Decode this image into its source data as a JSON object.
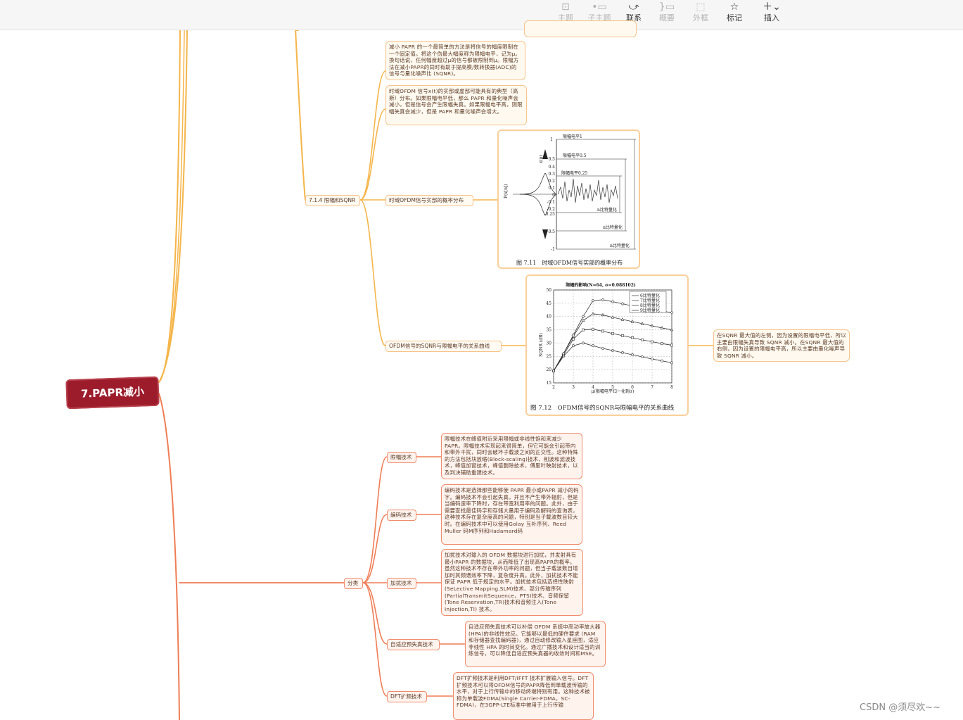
{
  "toolbar": {
    "items": [
      {
        "label": "主题",
        "icon": "topic-icon",
        "enabled": false
      },
      {
        "label": "子主题",
        "icon": "subtopic-icon",
        "enabled": false
      },
      {
        "label": "联系",
        "icon": "relationship-icon",
        "enabled": true
      },
      {
        "label": "概要",
        "icon": "summary-icon",
        "enabled": false
      },
      {
        "label": "外框",
        "icon": "boundary-icon",
        "enabled": false
      },
      {
        "label": "标记",
        "icon": "star-icon",
        "enabled": true
      },
      {
        "label": "插入",
        "icon": "plus-icon",
        "enabled": true
      }
    ]
  },
  "root": {
    "label": "7.PAPR减小"
  },
  "section": {
    "label": "7.1.4 限幅和SQNR",
    "note1": "减小 PAPR 的一个最简单的方法是将信号的幅度限制在一个固定值。将这个伪最大幅度称为限幅电平，记为μ。换句话说，任何幅度超过μ的信号都被限制到μ。限幅方法在减小PAPR的同时有助于提高模/数转换器(ADC)的信号与量化噪声比 (SQNR)。",
    "note2": "时域OFDM 信号x(t)的实部或虚部可能具有的典型（高斯）分布。如果限幅电平低，那么 PAPR 和量化噪声会减小，但是信号会产生限幅失真。如果限幅电平高，则限幅失真会减少，但是 PAPR 和量化噪声会增大。",
    "prob_label": "时域OFDM信号实部的概率分布",
    "sqnr_label": "OFDM信号的SQNR与限幅电平的关系曲线",
    "sqnr_note": "在SQNR 最大值的左侧，因为设置的限幅电平低，所以主要由限幅失真导致 SQNR 减小。在SQNR 最大值的右侧，因为设置的限幅电平高，所以主要由量化噪声导致 SQNR 减小。"
  },
  "figure711": {
    "caption": "图 7.11　时域OFDM信号实部的概率分布",
    "level1": "限幅电平1",
    "level05": "限幅电平0.5",
    "level025": "限幅电平0.25",
    "q1": "n比特量化",
    "q2": "n比特量化",
    "q3": "n比特量化",
    "pdf_label": "P(x[n])",
    "xn_label": "x(n)",
    "ticks": [
      "1",
      "0.5",
      "0.4",
      "0.3",
      "0.2",
      "0.1",
      "0",
      "-0.1",
      "-0.2",
      "-0.25",
      "-0.5",
      "-1"
    ]
  },
  "chart_data": {
    "type": "line",
    "title": "限幅的影响(N=64, σ=0.088102)",
    "xlabel": "μ(限幅电平归一化到σ)",
    "ylabel": "SQNR (dB)",
    "xlim": [
      2,
      8
    ],
    "ylim": [
      15,
      50
    ],
    "xticks": [
      "2",
      "3",
      "4",
      "5",
      "6",
      "7",
      "8"
    ],
    "yticks": [
      "15",
      "20",
      "25",
      "30",
      "35",
      "40",
      "45",
      "50"
    ],
    "legend": "top-right",
    "grid": true,
    "x": [
      2,
      2.5,
      3,
      3.5,
      4,
      4.5,
      5,
      5.5,
      6,
      6.5,
      7,
      7.5,
      8
    ],
    "series": [
      {
        "name": "6比特量化",
        "values": [
          19.5,
          25,
          29,
          30,
          29,
          28,
          27.2,
          26.4,
          25.6,
          24.8,
          24,
          23.3,
          22.6
        ]
      },
      {
        "name": "7比特量化",
        "values": [
          19.5,
          25.5,
          31.5,
          35,
          35.2,
          34.5,
          33.6,
          32.8,
          32,
          31.2,
          30.5,
          29.8,
          29.2
        ]
      },
      {
        "name": "8比特量化",
        "values": [
          19.5,
          26,
          32.5,
          38.5,
          41,
          40.6,
          39.7,
          38.9,
          38.1,
          37.3,
          36.5,
          35.7,
          35
        ]
      },
      {
        "name": "9比特量化",
        "values": [
          19.5,
          26,
          33,
          40,
          46,
          46.3,
          45.6,
          44.8,
          44,
          43.3,
          42.6,
          42,
          41.5
        ]
      }
    ]
  },
  "figure712": {
    "caption": "图 7.12　OFDM信号的SQNR与限幅电平的关系曲线"
  },
  "classify": {
    "label": "分类",
    "items": [
      {
        "label": "限幅技术",
        "text": "限幅技术在峰值附近采用限幅或非线性饱和来减少PAPR。限幅技术实现起来很简单，但它可能会引起带内和带外干扰，同时会破坏子载波之间的正交性。这种特殊的方法包括块放缩(Block-scaling)技术、削波和滤波技术，峰值加窗技术，峰值删除技术，傅里叶映射技术，以及判决辅助重建技术。"
      },
      {
        "label": "编码技术",
        "text": "编码技术是选择那些能够使 PAPR 最小或PAPR 减小的码字。编码技术不会引起失真，并且不产生带外辐射，但是当编码速率下降时，存在带宽利用率的问题。此外，由于需要查找最佳码字和存储大量用于编码及解码的查询表，这种技术存在复杂度高的问题，特别是当子载波数目较大时。在编码技术中可以使用Golay 互补序列、Reed Muller 码M序列和Hadamard码"
      },
      {
        "label": "加扰技术",
        "text": "加扰技术对输入的 OFDM 数据块进行加扰，并发射具有最小PAPR 的数据块，从而降低了出现高PAPR的概率。虽然这种技术不存在带外功率的问题，但当子载波数目增加时其频谱效率下降，复杂度升高。此外，加扰技术不能保证 PAPR 低于规定的水平。加扰技术包括选择性映射(SeLective Mapping,SLM)技术、部分传输序列(PartialTransmitSequence，PTS)技术、音频保留(Tone Reservation,TR)技术和音频注入(Tone Injection,TI) 技术。"
      },
      {
        "label": "自适应预失真技术",
        "text": "自适应预失真技术可以补偿 OFDM 系统中高功率放大器 (HPA)的非线性效应。它能够以最低的硬件要求 (RAM 和存储器查找编码器)，通过自动修改输入星座图，适应非线性 HPA 的时间变化。通过广播技术和设计适当的训练信号，可以降低自适应预失真器的收敛时间和MSE。"
      },
      {
        "label": "DFT扩频技术",
        "text": "DFT扩频技术是利用DFT/IFFT 技术扩展输入信号。DFT 扩频技术可以将OFDM信号的PAPR降低到单载波传输的水平，对于上行传输中的移动终端特别有用。这种技术被称为单载波FDMA(Single Carrier-FDMA，SC-FDMA)，在3GPP-LTE标准中被用于上行传输"
      }
    ]
  },
  "watermark": "CSDN @须尽欢~~",
  "colors": {
    "root": "#9c1c2c",
    "yellow_branch": "#f5b54a",
    "orange_branch": "#ef7d55",
    "toolbar_bg": "#f6f6f6"
  }
}
